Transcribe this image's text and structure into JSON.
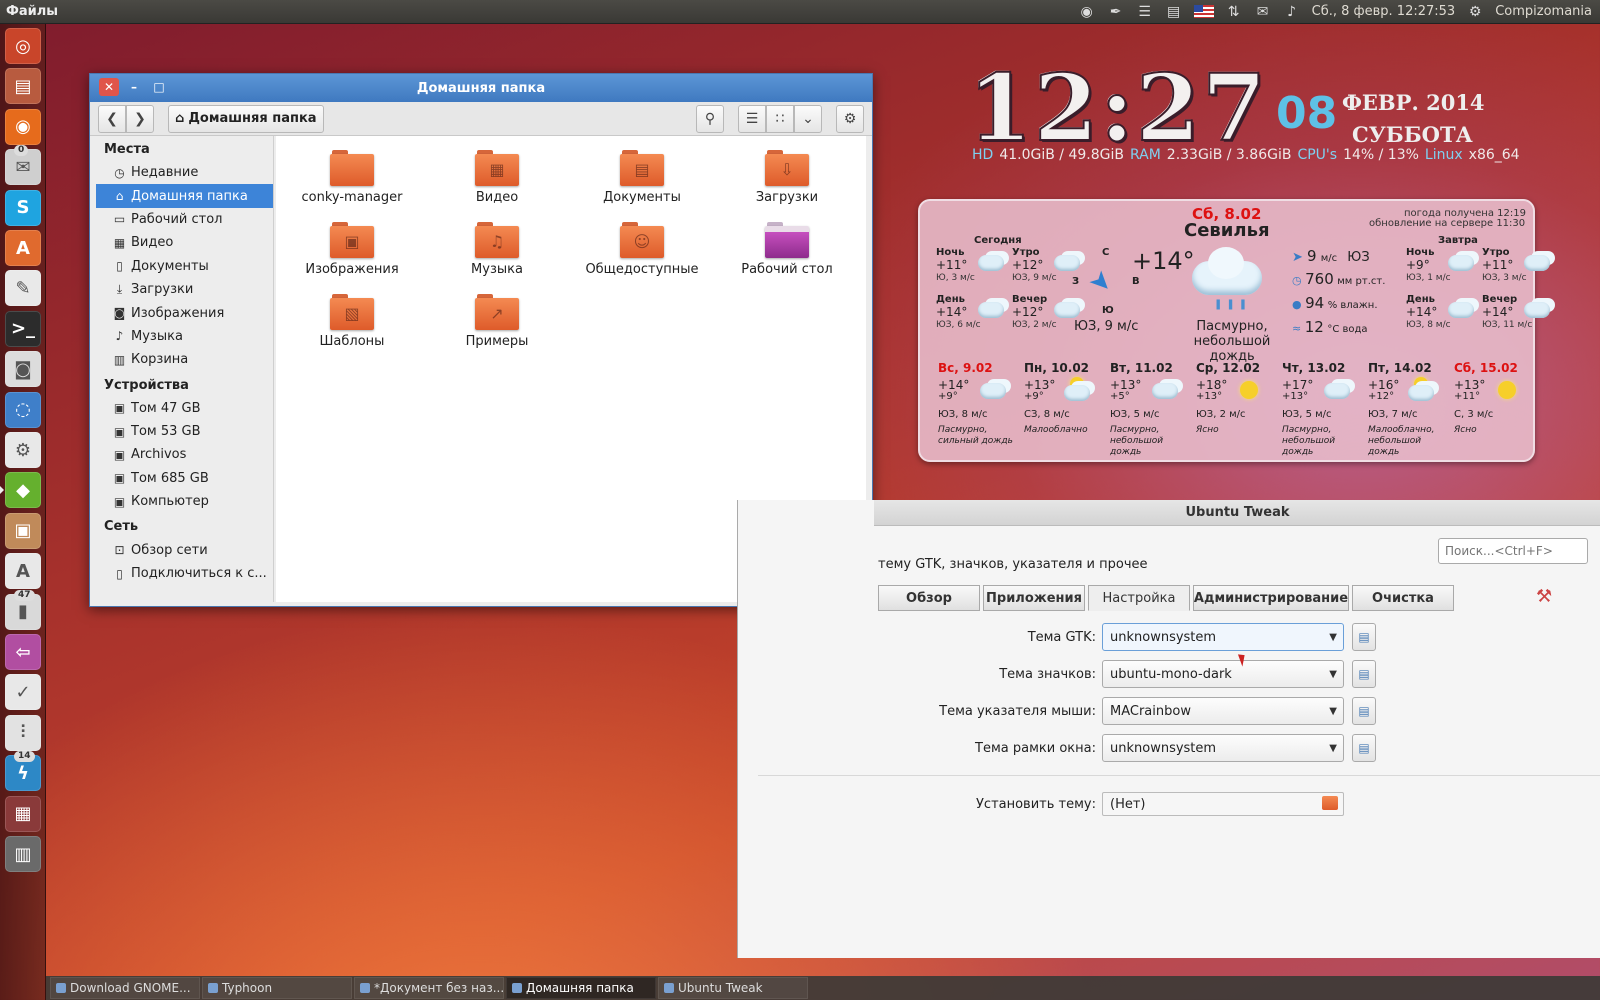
{
  "top_panel": {
    "app_name": "Файлы",
    "datetime": "Сб., 8 февр. 12:27:53",
    "user": "Compizomania",
    "indicators": [
      "bulb-icon",
      "brush-icon",
      "list-icon",
      "calendar-icon",
      "flag-us-icon",
      "network-icon",
      "mail-icon",
      "volume-icon",
      "gear-icon"
    ]
  },
  "launcher": {
    "items": [
      {
        "name": "dash-home",
        "icon": "ubuntu-logo-icon",
        "color": "#c9452a",
        "badge": ""
      },
      {
        "name": "files",
        "icon": "files-icon",
        "color": "#b85b3f",
        "badge": ""
      },
      {
        "name": "firefox",
        "icon": "firefox-icon",
        "color": "#e66b1c",
        "badge": ""
      },
      {
        "name": "messaging",
        "icon": "chat-icon",
        "color": "#cfcfcf",
        "badge": "0"
      },
      {
        "name": "skype",
        "icon": "skype-icon",
        "color": "#1fa4e0",
        "badge": ""
      },
      {
        "name": "software-center",
        "icon": "bag-icon",
        "color": "#e06a2e",
        "badge": ""
      },
      {
        "name": "text-editor",
        "icon": "pencil-icon",
        "color": "#e9e9e9",
        "badge": ""
      },
      {
        "name": "terminal",
        "icon": "terminal-icon",
        "color": "#2c2c2c",
        "badge": ""
      },
      {
        "name": "camera",
        "icon": "camera-icon",
        "color": "#dcdcdc",
        "badge": ""
      },
      {
        "name": "browser-2",
        "icon": "globe-icon",
        "color": "#3f7fc9",
        "badge": ""
      },
      {
        "name": "settings",
        "icon": "gear-icon",
        "color": "#e8e8e8",
        "badge": ""
      },
      {
        "name": "ubuntu-tweak",
        "icon": "tweak-icon",
        "color": "#65b02e",
        "badge": ""
      },
      {
        "name": "installer",
        "icon": "box-icon",
        "color": "#c08a5a",
        "badge": ""
      },
      {
        "name": "updater",
        "icon": "update-icon",
        "color": "#e8e8e8",
        "badge": ""
      },
      {
        "name": "thermometer",
        "icon": "thermometer-icon",
        "color": "#d9d9d9",
        "badge": "47"
      },
      {
        "name": "switch",
        "icon": "arrow-icon",
        "color": "#b14ea1",
        "badge": ""
      },
      {
        "name": "tasks",
        "icon": "check-icon",
        "color": "#e8e8e8",
        "badge": ""
      },
      {
        "name": "mixer",
        "icon": "mixer-icon",
        "color": "#e2e2e2",
        "badge": ""
      },
      {
        "name": "power",
        "icon": "lightning-icon",
        "color": "#2d88c6",
        "badge": "14"
      },
      {
        "name": "workspaces",
        "icon": "workspace-icon",
        "color": "#8a3a3a",
        "badge": ""
      },
      {
        "name": "trash",
        "icon": "trash-icon",
        "color": "#6a6a6a",
        "badge": ""
      }
    ]
  },
  "conky": {
    "time": "12:27",
    "day": "08",
    "month_year": "ФЕВР. 2014",
    "weekday": "СУББОТА",
    "stats": [
      {
        "k": "HD",
        "v": "41.0GiB / 49.8GiB"
      },
      {
        "k": "RAM",
        "v": "2.33GiB / 3.86GiB"
      },
      {
        "k": "CPU's",
        "v": "14% / 13%"
      },
      {
        "k": "Linux",
        "v": "x86_64"
      }
    ]
  },
  "weather": {
    "date": "Сб, 8.02",
    "city": "Севилья",
    "received": "погода получена 12:19",
    "updated": "обновление на сервере 11:30",
    "today_label": "Сегодня",
    "tomorrow_label": "Завтра",
    "today": [
      {
        "label": "Ночь",
        "t": "+11°",
        "w": "Ю, 3 м/с"
      },
      {
        "label": "Утро",
        "t": "+12°",
        "w": "ЮЗ, 9 м/с"
      },
      {
        "label": "День",
        "t": "+14°",
        "w": "ЮЗ, 6 м/с"
      },
      {
        "label": "Вечер",
        "t": "+12°",
        "w": "ЮЗ, 2 м/с"
      }
    ],
    "tomorrow": [
      {
        "label": "Ночь",
        "t": "+9°",
        "w": "ЮЗ, 1 м/с"
      },
      {
        "label": "Утро",
        "t": "+11°",
        "w": "ЮЗ, 3 м/с"
      },
      {
        "label": "День",
        "t": "+14°",
        "w": "ЮЗ, 8 м/с"
      },
      {
        "label": "Вечер",
        "t": "+14°",
        "w": "ЮЗ, 11 м/с"
      }
    ],
    "compass": {
      "n": "С",
      "s": "Ю",
      "w": "З",
      "e": "В"
    },
    "current_temp": "+14°",
    "wind_now": "ЮЗ, 9 м/с",
    "condition": "Пасмурно, небольшой дождь",
    "wind_speed": "9",
    "wind_unit": "м/с",
    "wind_dir": "ЮЗ",
    "pressure": "760",
    "pressure_unit": "мм рт.ст.",
    "humidity": "94",
    "humidity_unit": "% влажн.",
    "water": "12",
    "water_unit": "°С вода",
    "forecast": [
      {
        "day": "Вс, 9.02",
        "hi": "+14°",
        "lo": "+9°",
        "wind": "ЮЗ, 8 м/с",
        "desc": "Пасмурно, сильный дождь",
        "red": true,
        "icon": "cloud"
      },
      {
        "day": "Пн, 10.02",
        "hi": "+13°",
        "lo": "+9°",
        "wind": "СЗ, 8 м/с",
        "desc": "Малооблачно",
        "red": false,
        "icon": "suncloud"
      },
      {
        "day": "Вт, 11.02",
        "hi": "+13°",
        "lo": "+5°",
        "wind": "ЮЗ, 5 м/с",
        "desc": "Пасмурно, небольшой дождь",
        "red": false,
        "icon": "cloud"
      },
      {
        "day": "Ср, 12.02",
        "hi": "+18°",
        "lo": "+13°",
        "wind": "ЮЗ, 2 м/с",
        "desc": "Ясно",
        "red": false,
        "icon": "sun"
      },
      {
        "day": "Чт, 13.02",
        "hi": "+17°",
        "lo": "+13°",
        "wind": "ЮЗ, 5 м/с",
        "desc": "Пасмурно, небольшой дождь",
        "red": false,
        "icon": "cloud"
      },
      {
        "day": "Пт, 14.02",
        "hi": "+16°",
        "lo": "+12°",
        "wind": "ЮЗ, 7 м/с",
        "desc": "Малооблачно, небольшой дождь",
        "red": false,
        "icon": "suncloud"
      },
      {
        "day": "Сб, 15.02",
        "hi": "+13°",
        "lo": "+11°",
        "wind": "С, 3 м/с",
        "desc": "Ясно",
        "red": true,
        "icon": "sun"
      }
    ]
  },
  "file_manager": {
    "title": "Домашняя папка",
    "breadcrumb": "Домашняя папка",
    "sidebar": {
      "places_label": "Места",
      "places": [
        {
          "label": "Недавние",
          "icon": "clock-icon",
          "sel": false
        },
        {
          "label": "Домашняя папка",
          "icon": "home-icon",
          "sel": true
        },
        {
          "label": "Рабочий стол",
          "icon": "desktop-icon",
          "sel": false
        },
        {
          "label": "Видео",
          "icon": "film-icon",
          "sel": false
        },
        {
          "label": "Документы",
          "icon": "document-icon",
          "sel": false
        },
        {
          "label": "Загрузки",
          "icon": "download-icon",
          "sel": false
        },
        {
          "label": "Изображения",
          "icon": "camera-icon",
          "sel": false
        },
        {
          "label": "Музыка",
          "icon": "music-icon",
          "sel": false
        },
        {
          "label": "Корзина",
          "icon": "trash-icon",
          "sel": false
        }
      ],
      "devices_label": "Устройства",
      "devices": [
        {
          "label": "Том 47 GB",
          "icon": "drive-icon"
        },
        {
          "label": "Том 53 GB",
          "icon": "drive-icon"
        },
        {
          "label": "Archivos",
          "icon": "drive-icon"
        },
        {
          "label": "Том 685 GB",
          "icon": "drive-icon"
        },
        {
          "label": "Компьютер",
          "icon": "drive-icon"
        }
      ],
      "network_label": "Сеть",
      "network": [
        {
          "label": "Обзор сети",
          "icon": "network-icon"
        },
        {
          "label": "Подключиться к с...",
          "icon": "server-icon"
        }
      ]
    },
    "items": [
      {
        "label": "conky-manager",
        "emblem": "",
        "purple": false
      },
      {
        "label": "Видео",
        "emblem": "▦",
        "purple": false
      },
      {
        "label": "Документы",
        "emblem": "▤",
        "purple": false
      },
      {
        "label": "Загрузки",
        "emblem": "⇩",
        "purple": false
      },
      {
        "label": "Изображения",
        "emblem": "▣",
        "purple": false
      },
      {
        "label": "Музыка",
        "emblem": "♫",
        "purple": false
      },
      {
        "label": "Общедоступные",
        "emblem": "☺",
        "purple": false
      },
      {
        "label": "Рабочий стол",
        "emblem": "",
        "purple": true
      },
      {
        "label": "Шаблоны",
        "emblem": "▧",
        "purple": false
      },
      {
        "label": "Примеры",
        "emblem": "↗",
        "purple": false
      }
    ]
  },
  "tweak": {
    "title": "Ubuntu Tweak",
    "description": "тему GTK, значков, указателя и прочее",
    "search_placeholder": "Поиск...<Ctrl+F>",
    "tabs": [
      {
        "label": "Обзор",
        "active": false
      },
      {
        "label": "Приложения",
        "active": false
      },
      {
        "label": "Настройка",
        "active": true
      },
      {
        "label": "Администрирование",
        "active": false
      },
      {
        "label": "Очистка",
        "active": false
      }
    ],
    "rows": [
      {
        "label": "Тема GTK:",
        "value": "unknownsystem"
      },
      {
        "label": "Тема значков:",
        "value": "ubuntu-mono-dark"
      },
      {
        "label": "Тема указателя мыши:",
        "value": "MACrainbow"
      },
      {
        "label": "Тема рамки окна:",
        "value": "unknownsystem"
      }
    ],
    "install_label": "Установить тему:",
    "install_value": "(Нет)"
  },
  "taskbar": [
    {
      "label": "Download GNOME...",
      "active": false
    },
    {
      "label": "Typhoon",
      "active": false
    },
    {
      "label": "*Документ без наз...",
      "active": false
    },
    {
      "label": "Домашняя папка",
      "active": true
    },
    {
      "label": "Ubuntu Tweak",
      "active": false
    }
  ]
}
